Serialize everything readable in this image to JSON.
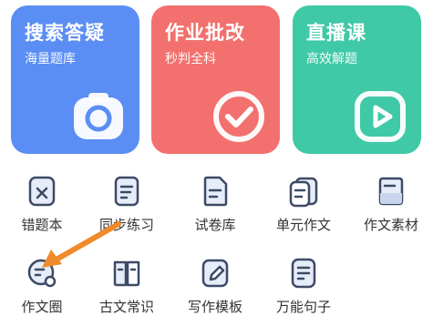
{
  "cards": [
    {
      "title": "搜索答疑",
      "subtitle": "海量题库",
      "icon": "camera-icon",
      "color": "#5B8EF4"
    },
    {
      "title": "作业批改",
      "subtitle": "秒判全科",
      "icon": "check-circle-icon",
      "color": "#F2716E"
    },
    {
      "title": "直播课",
      "subtitle": "高效解题",
      "icon": "play-icon",
      "color": "#3FC9A6"
    }
  ],
  "grid": {
    "row1": [
      {
        "label": "错题本",
        "icon": "wrong-notebook-icon"
      },
      {
        "label": "同步练习",
        "icon": "practice-notebook-icon"
      },
      {
        "label": "试卷库",
        "icon": "exam-paper-icon"
      },
      {
        "label": "单元作文",
        "icon": "unit-essay-icon"
      },
      {
        "label": "作文素材",
        "icon": "essay-material-icon"
      }
    ],
    "row2": [
      {
        "label": "作文圈",
        "icon": "essay-circle-icon"
      },
      {
        "label": "古文常识",
        "icon": "classical-chinese-icon"
      },
      {
        "label": "写作模板",
        "icon": "writing-template-icon"
      },
      {
        "label": "万能句子",
        "icon": "universal-sentence-icon"
      }
    ]
  },
  "annotation": {
    "arrow_color": "#F08A2A"
  }
}
